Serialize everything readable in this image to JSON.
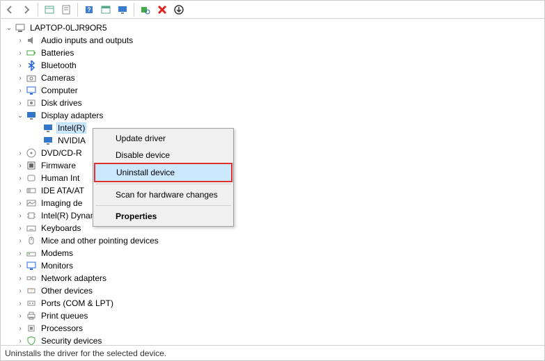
{
  "toolbar": {
    "back": "Back",
    "forward": "Forward",
    "show_hidden": "Show hidden devices",
    "properties": "Properties",
    "help": "Help",
    "action": "Action",
    "view": "View",
    "scan": "Scan for hardware changes",
    "remove": "Uninstall device",
    "add": "Add legacy hardware"
  },
  "tree": {
    "root": {
      "label": "LAPTOP-0LJR9OR5",
      "expanded": true
    },
    "categories": [
      {
        "label": "Audio inputs and outputs",
        "expanded": false,
        "icon": "audio"
      },
      {
        "label": "Batteries",
        "expanded": false,
        "icon": "battery"
      },
      {
        "label": "Bluetooth",
        "expanded": false,
        "icon": "bluetooth"
      },
      {
        "label": "Cameras",
        "expanded": false,
        "icon": "camera"
      },
      {
        "label": "Computer",
        "expanded": false,
        "icon": "computer"
      },
      {
        "label": "Disk drives",
        "expanded": false,
        "icon": "disk"
      },
      {
        "label": "Display adapters",
        "expanded": true,
        "icon": "display",
        "children": [
          {
            "label": "Intel(R)",
            "selected": true,
            "truncated": true
          },
          {
            "label": "NVIDIA",
            "truncated": true
          }
        ]
      },
      {
        "label": "DVD/CD-R",
        "expanded": false,
        "icon": "dvd",
        "truncated": true
      },
      {
        "label": "Firmware",
        "expanded": false,
        "icon": "firmware"
      },
      {
        "label": "Human Int",
        "expanded": false,
        "icon": "hid",
        "truncated": true
      },
      {
        "label": "IDE ATA/AT",
        "expanded": false,
        "icon": "ide",
        "truncated": true
      },
      {
        "label": "Imaging de",
        "expanded": false,
        "icon": "imaging",
        "truncated": true
      },
      {
        "label": "Intel(R) Dynamic Platform and Thermal Framework",
        "expanded": false,
        "icon": "chip"
      },
      {
        "label": "Keyboards",
        "expanded": false,
        "icon": "keyboard"
      },
      {
        "label": "Mice and other pointing devices",
        "expanded": false,
        "icon": "mouse"
      },
      {
        "label": "Modems",
        "expanded": false,
        "icon": "modem"
      },
      {
        "label": "Monitors",
        "expanded": false,
        "icon": "monitor"
      },
      {
        "label": "Network adapters",
        "expanded": false,
        "icon": "network"
      },
      {
        "label": "Other devices",
        "expanded": false,
        "icon": "other"
      },
      {
        "label": "Ports (COM & LPT)",
        "expanded": false,
        "icon": "port"
      },
      {
        "label": "Print queues",
        "expanded": false,
        "icon": "printer"
      },
      {
        "label": "Processors",
        "expanded": false,
        "icon": "cpu"
      },
      {
        "label": "Security devices",
        "expanded": false,
        "icon": "security"
      }
    ]
  },
  "context_menu": {
    "update_driver": "Update driver",
    "disable_device": "Disable device",
    "uninstall_device": "Uninstall device",
    "scan_hardware": "Scan for hardware changes",
    "properties": "Properties"
  },
  "statusbar": {
    "text": "Uninstalls the driver for the selected device."
  },
  "colors": {
    "highlight_border": "#e03030",
    "selection_bg": "#cce8ff"
  }
}
